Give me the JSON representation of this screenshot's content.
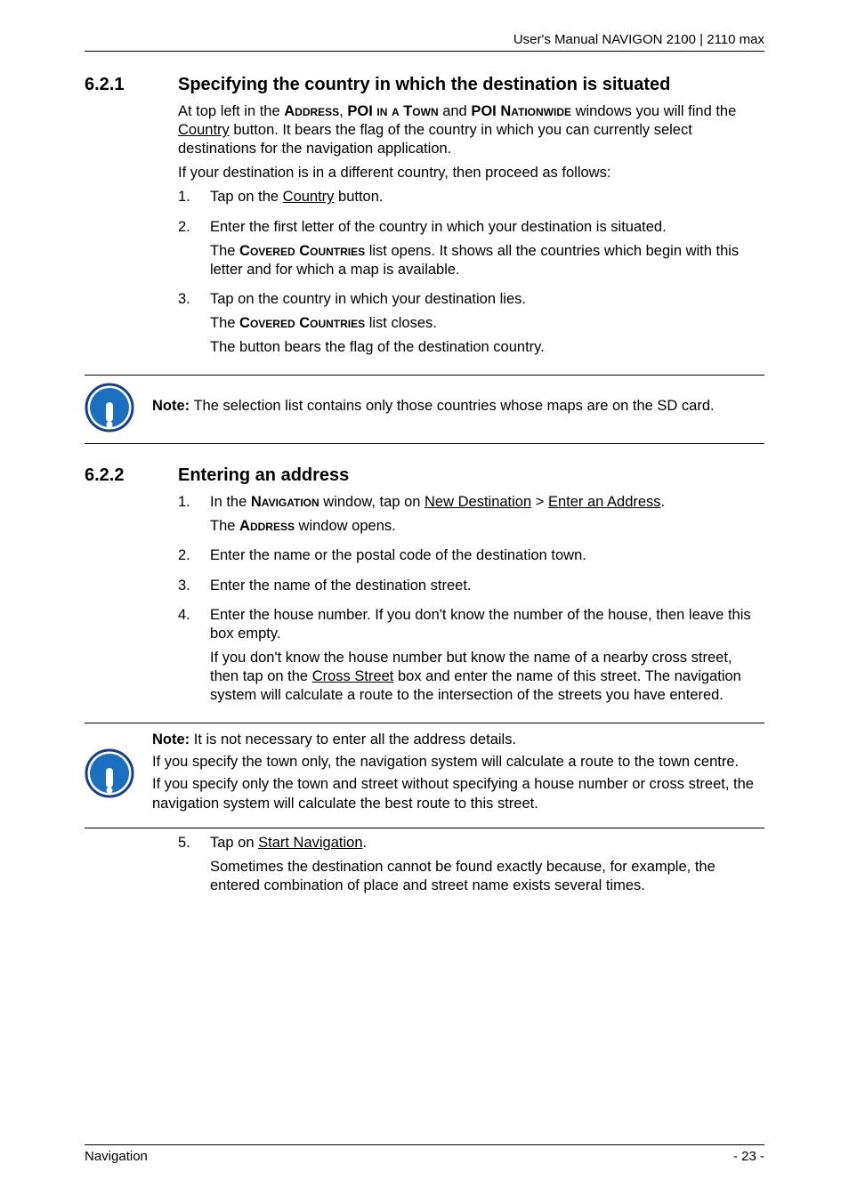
{
  "header": {
    "text": "User's Manual NAVIGON 2100 | 2110 max"
  },
  "section1": {
    "number": "6.2.1",
    "title": "Specifying the country in which the destination is situated",
    "intro_p1_a": "At top left in the ",
    "intro_p1_addr": "Address",
    "intro_p1_b": ", ",
    "intro_p1_poi1": "POI in a Town",
    "intro_p1_c": " and ",
    "intro_p1_poi2": "POI Nationwide",
    "intro_p1_d": " windows you will find the ",
    "intro_p1_country": "Country",
    "intro_p1_e": " button. It bears the flag of the country in which you can currently select destinations for the navigation application.",
    "intro_p2": "If your destination is in a different country, then proceed as follows:",
    "step1_num": "1.",
    "step1_a": "Tap on the ",
    "step1_country": "Country",
    "step1_b": " button.",
    "step2_num": "2.",
    "step2_a": "Enter the first letter of the country in which your destination is situated.",
    "step2_b_a": "The ",
    "step2_b_cc": "Covered Countries",
    "step2_b_b": " list opens. It shows all the countries which begin with this letter and for which a map is available.",
    "step3_num": "3.",
    "step3_a": "Tap on the country in which your destination lies.",
    "step3_b_a": "The ",
    "step3_b_cc": "Covered Countries",
    "step3_b_b": " list closes.",
    "step3_c": "The button bears the flag of the destination country."
  },
  "note1": {
    "label": "Note:",
    "text": " The selection list contains only those countries whose maps are on the SD card."
  },
  "section2": {
    "number": "6.2.2",
    "title": "Entering an address",
    "step1_num": "1.",
    "step1_a": "In the ",
    "step1_nav": "Navigation",
    "step1_b": " window, tap on ",
    "step1_newdest": "New Destination",
    "step1_c": " > ",
    "step1_enter": "Enter an Address",
    "step1_d": ".",
    "step1_p2_a": "The ",
    "step1_p2_addr": "Address",
    "step1_p2_b": " window opens.",
    "step2_num": "2.",
    "step2": "Enter the name or the postal code of the destination town.",
    "step3_num": "3.",
    "step3": "Enter the name of the destination street.",
    "step4_num": "4.",
    "step4_a": "Enter the house number. If you don't know the number of the house, then leave this box empty.",
    "step4_b_a": "If you don't know the house number but know the name of a nearby cross street, then tap on the ",
    "step4_b_cs": "Cross Street",
    "step4_b_b": " box and enter the name of this street. The navigation system will calculate a route to the intersection of the streets you have entered."
  },
  "note2": {
    "label": "Note:",
    "p1": " It is not necessary to enter all the address details.",
    "p2": "If you specify the town only, the navigation system will calculate a route to the town centre.",
    "p3": "If you specify only the town and street without specifying a house number or cross street, the navigation system will calculate the best route to this street."
  },
  "section2_cont": {
    "step5_num": "5.",
    "step5_a_a": "Tap on ",
    "step5_a_sn": "Start Navigation",
    "step5_a_b": ".",
    "step5_b": "Sometimes the destination cannot be found exactly because, for example, the entered combination of place and street name exists several times."
  },
  "footer": {
    "left": "Navigation",
    "right": "- 23 -"
  }
}
